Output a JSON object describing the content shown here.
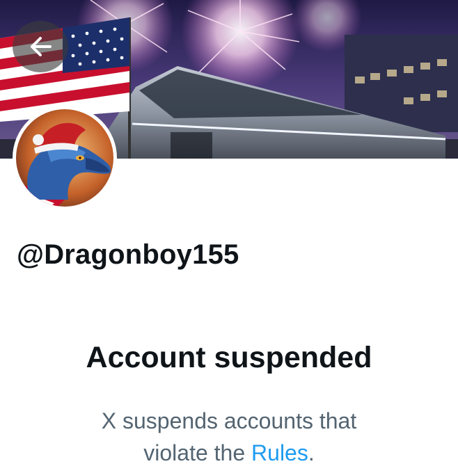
{
  "profile": {
    "handle": "@Dragonboy155"
  },
  "header": {
    "back_icon": "arrow-left-icon"
  },
  "banner": {
    "description_icon": "banner-image"
  },
  "suspension": {
    "title": "Account suspended",
    "message_line1": "X suspends accounts that",
    "message_line2_prefix": "violate the ",
    "rules_link": "Rules",
    "message_line2_suffix": "."
  },
  "colors": {
    "link": "#1d9bf0",
    "text_primary": "#0f1419",
    "text_secondary": "#536471"
  }
}
